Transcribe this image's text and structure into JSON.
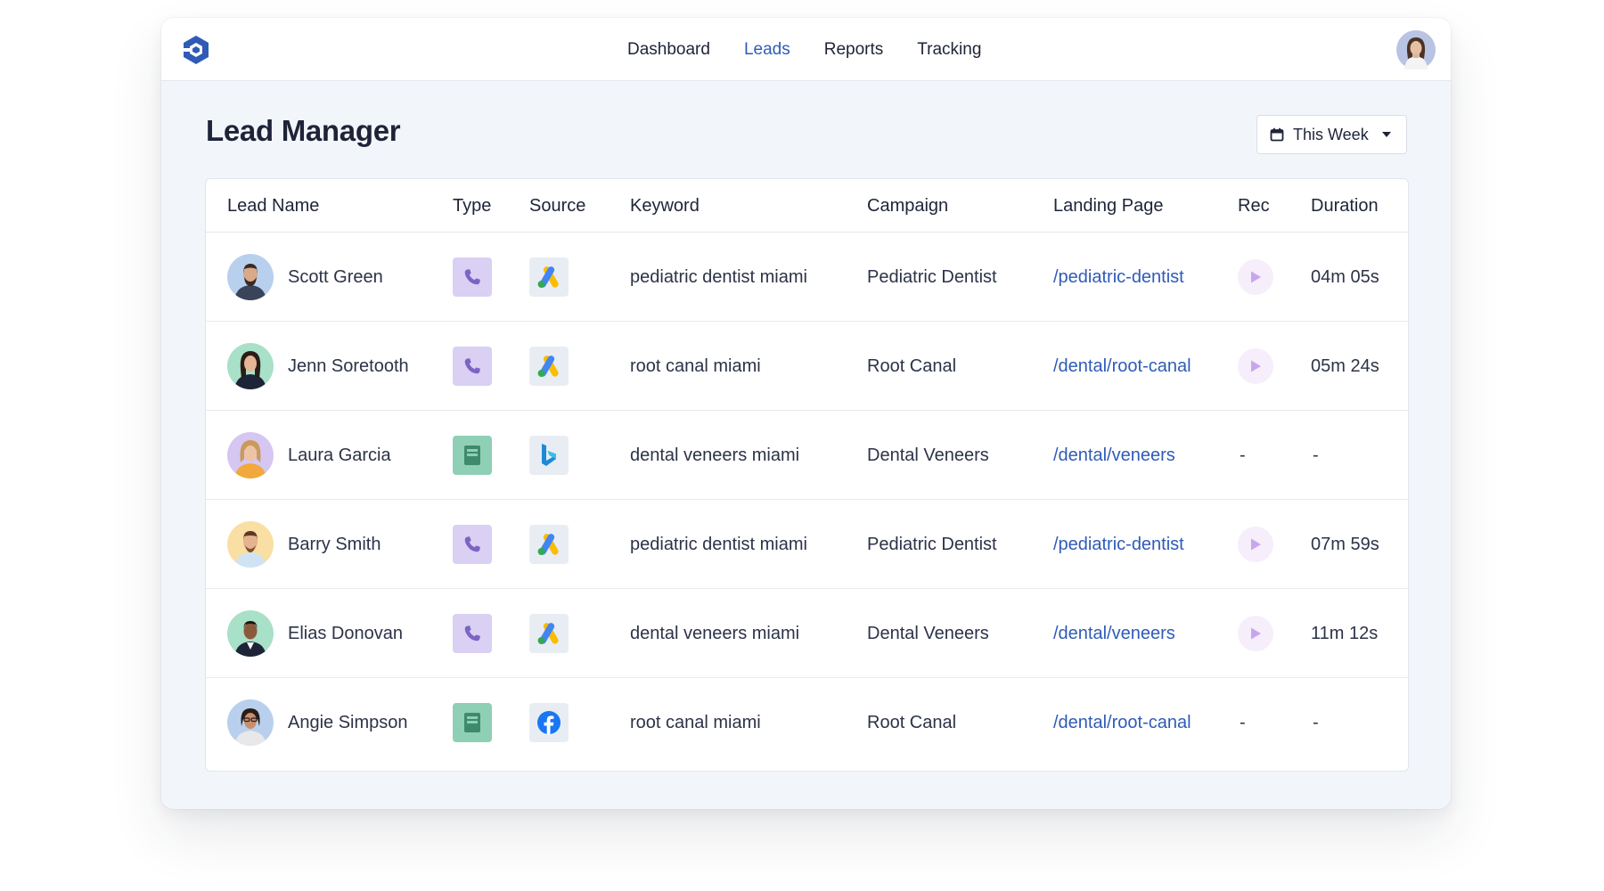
{
  "nav": {
    "items": [
      {
        "label": "Dashboard",
        "active": false
      },
      {
        "label": "Leads",
        "active": true
      },
      {
        "label": "Reports",
        "active": false
      },
      {
        "label": "Tracking",
        "active": false
      }
    ]
  },
  "page": {
    "title": "Lead Manager",
    "date_filter": "This Week"
  },
  "table": {
    "headers": [
      "Lead Name",
      "Type",
      "Source",
      "Keyword",
      "Campaign",
      "Landing Page",
      "Rec",
      "Duration"
    ],
    "rows": [
      {
        "name": "Scott Green",
        "type": "phone-icon",
        "source": "google-ads-icon",
        "keyword": "pediatric dentist miami",
        "campaign": "Pediatric Dentist",
        "landing": "/pediatric-dentist",
        "rec": true,
        "duration": "04m 05s"
      },
      {
        "name": "Jenn Soretooth",
        "type": "phone-icon",
        "source": "google-ads-icon",
        "keyword": "root canal miami",
        "campaign": "Root Canal",
        "landing": "/dental/root-canal",
        "rec": true,
        "duration": "05m 24s"
      },
      {
        "name": "Laura Garcia",
        "type": "form-icon",
        "source": "bing-icon",
        "keyword": "dental veneers miami",
        "campaign": "Dental Veneers",
        "landing": "/dental/veneers",
        "rec": "-",
        "duration": "-"
      },
      {
        "name": "Barry Smith",
        "type": "phone-icon",
        "source": "google-ads-icon",
        "keyword": "pediatric dentist miami",
        "campaign": "Pediatric Dentist",
        "landing": "/pediatric-dentist",
        "rec": true,
        "duration": "07m 59s"
      },
      {
        "name": "Elias Donovan",
        "type": "phone-icon",
        "source": "google-ads-icon",
        "keyword": "dental veneers miami",
        "campaign": "Dental Veneers",
        "landing": "/dental/veneers",
        "rec": true,
        "duration": "11m 12s"
      },
      {
        "name": "Angie Simpson",
        "type": "form-icon",
        "source": "facebook-icon",
        "keyword": "root canal miami",
        "campaign": "Root Canal",
        "landing": "/dental/root-canal",
        "rec": "-",
        "duration": "-"
      }
    ]
  },
  "colors": {
    "accent": "#2f5bb7",
    "phone_badge": "#d9d0f3",
    "form_badge": "#8fcfb5",
    "play_bg": "#f6eefb",
    "play_icon": "#c8a6ee"
  }
}
